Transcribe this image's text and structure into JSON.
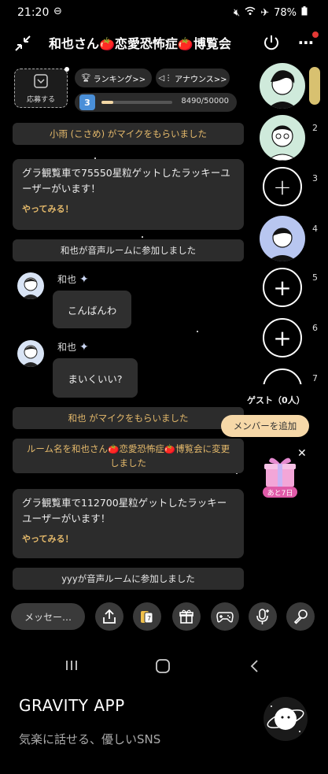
{
  "status_bar": {
    "time": "21:20",
    "time_icon": "minus-circle-icon",
    "battery": "78%",
    "icons": [
      "mute-icon",
      "wifi-icon",
      "airplane-icon",
      "battery-icon"
    ]
  },
  "header": {
    "title": "和也さん🍅恋愛恐怖症🍅博覧会",
    "notify_color": "#e53935"
  },
  "apply_button": {
    "label": "応募する"
  },
  "ranking_button": {
    "label": "ランキング>>"
  },
  "announce_button": {
    "label": "アナウンス>>"
  },
  "level": {
    "badge": "3",
    "value_text": "8490/50000",
    "progress": 0.17
  },
  "messages": {
    "mic1": "小雨 (こさめ) がマイクをもらいました",
    "lucky1_text": "グラ観覧車で75550星粒ゲットしたラッキーユーザーがいます！",
    "lucky1_link": "やってみる！",
    "join1": "和也が音声ルームに参加しました",
    "chat1_name": "和也",
    "chat1_text": "こんばんわ",
    "chat2_name": "和也",
    "chat2_text": "まいくいい?",
    "mic2": "和也 がマイクをもらいました",
    "rename_text": "ルーム名を和也さん🍅恋愛恐怖症🍅博覧会に変更しました",
    "lucky2_text": "グラ観覧車で112700星粒ゲットしたラッキーユーザーがいます！",
    "lucky2_link": "やってみる！",
    "join2": "yyyが音声ルームに参加しました"
  },
  "seats": [
    {
      "num": "",
      "type": "host"
    },
    {
      "num": "2",
      "type": "avatar"
    },
    {
      "num": "3",
      "type": "empty"
    },
    {
      "num": "4",
      "type": "avatar"
    },
    {
      "num": "5",
      "type": "empty"
    },
    {
      "num": "6",
      "type": "empty"
    },
    {
      "num": "7",
      "type": "empty"
    }
  ],
  "guest": {
    "label": "ゲスト（0人）",
    "add_button": "メンバーを追加"
  },
  "gift_promo": {
    "label": "あと7日"
  },
  "bottom_bar": {
    "message_placeholder": "メッセー…"
  },
  "nav_bar": {
    "icons": [
      "recent-apps-icon",
      "home-icon",
      "back-icon"
    ]
  },
  "footer": {
    "app_name": "GRAVITY APP",
    "tagline": "気楽に話せる、優しいSNS"
  },
  "colors": {
    "accent": "#e4b96b",
    "add_button_bg": "#f6d8a8"
  }
}
